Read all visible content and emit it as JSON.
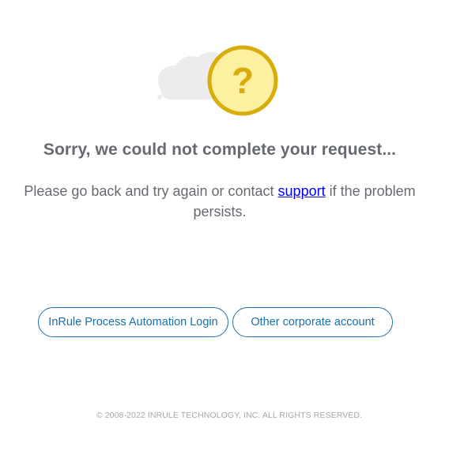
{
  "error": {
    "heading": "Sorry, we could not complete your request...",
    "message_before": "Please go back and try again or contact ",
    "support_link": "support",
    "message_after": " if the problem persists.",
    "badge_symbol": "?"
  },
  "buttons": {
    "login_label": "InRule Process Automation Login",
    "corporate_label": "Other corporate account"
  },
  "footer": {
    "copyright": "© 2008-2022 INRULE TECHNOLOGY, INC. ALL RIGHTS RESERVED."
  },
  "icons": {
    "cloud": "cloud-icon",
    "question": "question-mark-icon"
  },
  "colors": {
    "badge_fill": "#fdf0a0",
    "badge_ring": "#d8ad0b",
    "cloud": "#ececec",
    "accent": "#1a6fa8",
    "link": "#0000ee",
    "text": "#666a70",
    "footer_text": "#a4a7ab"
  }
}
